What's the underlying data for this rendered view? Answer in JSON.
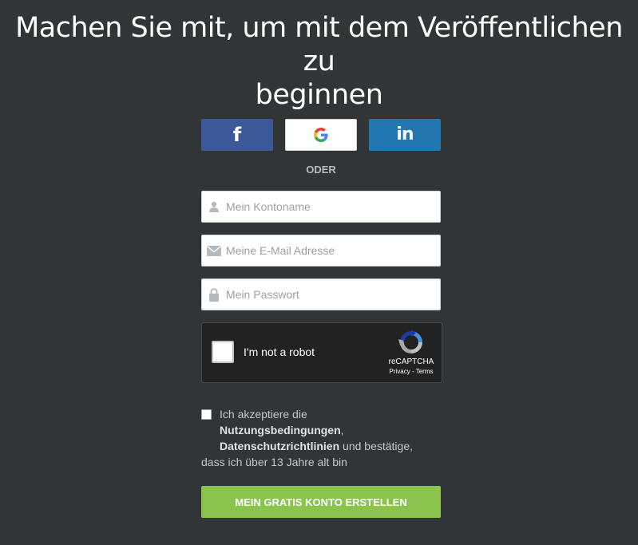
{
  "heading": {
    "line1": "Machen Sie mit, um mit dem Veröffentlichen zu",
    "line2": "beginnen"
  },
  "social": {
    "facebook_glyph": "f",
    "linkedin_glyph": "in"
  },
  "divider": "ODER",
  "form": {
    "username_placeholder": "Mein Kontoname",
    "email_placeholder": "Meine E-Mail Adresse",
    "password_placeholder": "Mein Passwort"
  },
  "captcha": {
    "label": "I'm not a robot",
    "brand": "reCAPTCHA",
    "privacy": "Privacy",
    "separator": " - ",
    "terms": "Terms"
  },
  "terms": {
    "prefix": "Ich akzeptiere die",
    "link_tos": "Nutzungsbedingungen",
    "comma": ",",
    "link_privacy": "Datenschutzrichtlinien",
    "mid": " und bestätige,",
    "suffix": "dass ich über 13 Jahre alt bin"
  },
  "submit_label": "MEIN GRATIS KONTO ERSTELLEN",
  "colors": {
    "background": "#313538",
    "facebook": "#3b5898",
    "linkedin": "#2277b1",
    "submit": "#8bc34f"
  }
}
